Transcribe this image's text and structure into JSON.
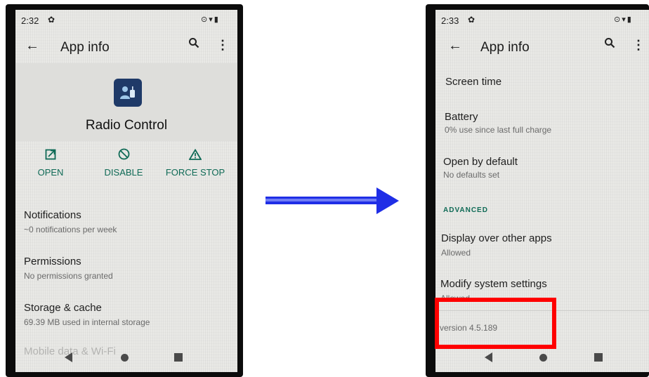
{
  "left_phone": {
    "status": {
      "time": "2:32"
    },
    "appbar": {
      "title": "App info"
    },
    "app": {
      "name": "Radio Control"
    },
    "actions": {
      "open": "OPEN",
      "disable": "DISABLE",
      "force_stop": "FORCE STOP"
    },
    "items": [
      {
        "title": "Notifications",
        "subtitle": "~0 notifications per week"
      },
      {
        "title": "Permissions",
        "subtitle": "No permissions granted"
      },
      {
        "title": "Storage & cache",
        "subtitle": "69.39 MB used in internal storage"
      },
      {
        "title": "Mobile data & Wi-Fi",
        "subtitle": ""
      }
    ]
  },
  "right_phone": {
    "status": {
      "time": "2:33"
    },
    "appbar": {
      "title": "App info"
    },
    "items": [
      {
        "title": "Screen time",
        "subtitle": ""
      },
      {
        "title": "Battery",
        "subtitle": "0% use since last full charge"
      },
      {
        "title": "Open by default",
        "subtitle": "No defaults set"
      }
    ],
    "section_header": "ADVANCED",
    "advanced_items": [
      {
        "title": "Display over other apps",
        "subtitle": "Allowed"
      },
      {
        "title": "Modify system settings",
        "subtitle": "Allowed"
      }
    ],
    "version": "version 4.5.189"
  },
  "icons": {
    "back": "arrow-left",
    "search": "search",
    "more": "more-vert",
    "settings": "gear",
    "open": "open-external",
    "disable": "disable-circle",
    "force_stop": "warning-triangle",
    "location": "location-pin",
    "wifi": "wifi",
    "battery": "battery",
    "nav_back": "triangle-left",
    "nav_home": "circle",
    "nav_recents": "square"
  },
  "colors": {
    "accent": "#0f6a56",
    "highlight": "#ff0000",
    "arrow": "#1f2ee6",
    "app_icon_bg": "#1f3a68"
  }
}
